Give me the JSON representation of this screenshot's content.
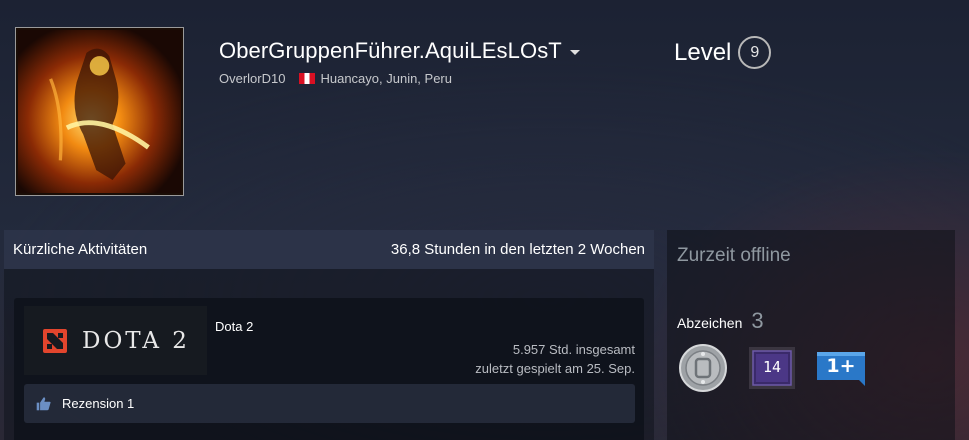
{
  "profile": {
    "persona_name": "OberGruppenFührer.AquiLEsLOsT",
    "account_name": "OverlorD10",
    "location": "Huancayo, Junin, Peru",
    "flag_icon": "peru-flag-icon",
    "avatar_icon": "fiery-hero-avatar"
  },
  "level": {
    "label": "Level",
    "value": "9"
  },
  "activity": {
    "title": "Kürzliche Aktivitäten",
    "summary": "36,8 Stunden in den letzten 2 Wochen",
    "games": [
      {
        "name": "Dota 2",
        "logo_text": "DOTA 2",
        "total_hours": "5.957 Std. insgesamt",
        "last_played": "zuletzt gespielt am 25. Sep.",
        "review_label": "Rezension 1",
        "review_icon": "thumbs-up-icon"
      }
    ]
  },
  "sidebar": {
    "status": "Zurzeit offline",
    "badges_label": "Abzeichen",
    "badges_count": "3",
    "badges": [
      {
        "icon": "silver-coin-badge-icon",
        "text": ""
      },
      {
        "icon": "years-of-service-badge-icon",
        "text": "14"
      },
      {
        "icon": "level-up-badge-icon",
        "text": "1+"
      }
    ]
  },
  "colors": {
    "accent_text": "#ebebeb",
    "muted": "#8f98a0",
    "header_bar": "#3c4660",
    "peru_red": "#d91023"
  }
}
